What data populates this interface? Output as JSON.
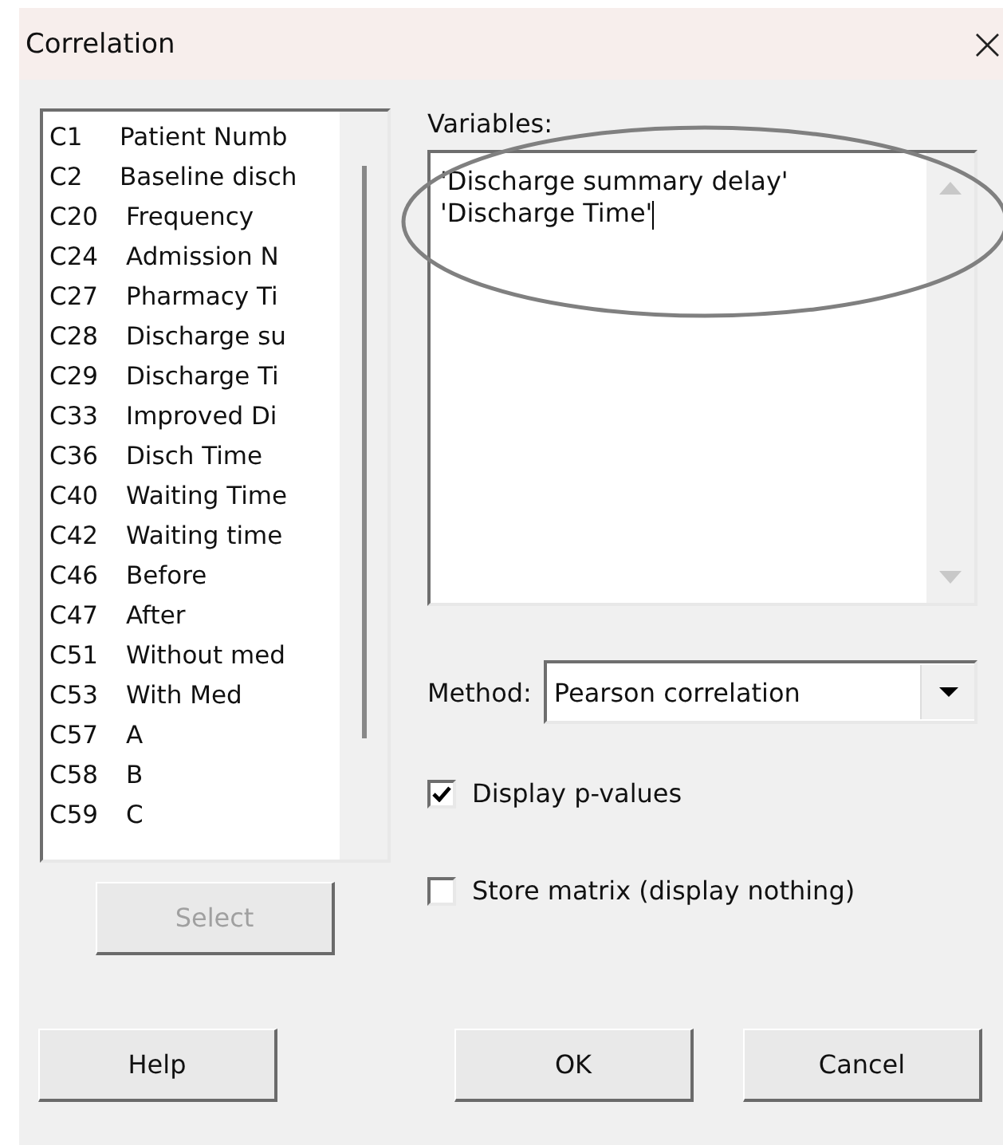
{
  "window": {
    "title": "Correlation",
    "close": "×"
  },
  "columns": [
    {
      "id": "C1",
      "name": "Patient Numb"
    },
    {
      "id": "C2",
      "name": "Baseline disch"
    },
    {
      "id": "C20",
      "name": "Frequency"
    },
    {
      "id": "C24",
      "name": "Admission N"
    },
    {
      "id": "C27",
      "name": "Pharmacy Ti"
    },
    {
      "id": "C28",
      "name": "Discharge su"
    },
    {
      "id": "C29",
      "name": "Discharge Ti"
    },
    {
      "id": "C33",
      "name": "Improved Di"
    },
    {
      "id": "C36",
      "name": "Disch Time"
    },
    {
      "id": "C40",
      "name": "Waiting Time"
    },
    {
      "id": "C42",
      "name": "Waiting time"
    },
    {
      "id": "C46",
      "name": "Before"
    },
    {
      "id": "C47",
      "name": "After"
    },
    {
      "id": "C51",
      "name": "Without med"
    },
    {
      "id": "C53",
      "name": "With Med"
    },
    {
      "id": "C57",
      "name": "A"
    },
    {
      "id": "C58",
      "name": "B"
    },
    {
      "id": "C59",
      "name": "C"
    }
  ],
  "select_button": {
    "label": "Select",
    "disabled": true
  },
  "variables": {
    "label": "Variables:",
    "lines": [
      "'Discharge summary delay'",
      "'Discharge Time'"
    ]
  },
  "method": {
    "label": "Method:",
    "value": "Pearson correlation"
  },
  "options": [
    {
      "label": "Display p-values",
      "checked": true
    },
    {
      "label": "Store matrix (display nothing)",
      "checked": false
    }
  ],
  "buttons": [
    "Help",
    "OK",
    "Cancel"
  ]
}
